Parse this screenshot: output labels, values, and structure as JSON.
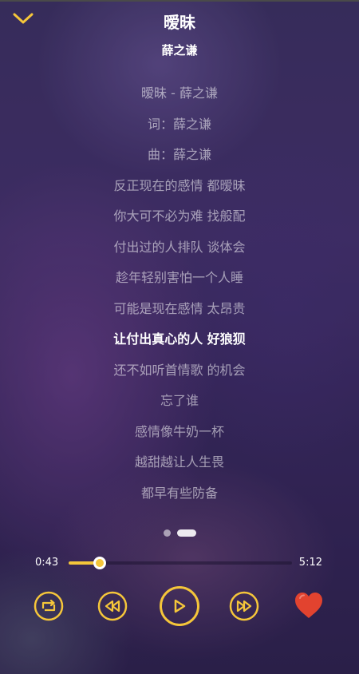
{
  "player": {
    "title": "暧昧",
    "artist": "薛之谦"
  },
  "lyrics": [
    "暧昧 - 薛之谦",
    "词：薛之谦",
    "曲：薛之谦",
    "反正现在的感情 都暧昧",
    "你大可不必为难 找般配",
    "付出过的人排队 谈体会",
    "趁年轻别害怕一个人睡",
    "可能是现在感情 太昂贵",
    "让付出真心的人 好狼狈",
    "还不如听首情歌 的机会",
    "忘了谁",
    "感情像牛奶一杯",
    "越甜越让人生畏",
    "都早有些防备"
  ],
  "active_line": 8,
  "pager": {
    "count": 2,
    "active": 1
  },
  "progress": {
    "elapsed": "0:43",
    "total": "5:12",
    "fraction": 0.138
  },
  "icons": {
    "collapse": "chevron-down-icon",
    "repeat": "repeat-icon",
    "previous": "rewind-icon",
    "play": "play-icon",
    "next": "fast-forward-icon",
    "favorite": "heart-icon"
  },
  "colors": {
    "accent": "#f5c63a",
    "favorite": "#e2432f",
    "text": "#ffffff"
  }
}
